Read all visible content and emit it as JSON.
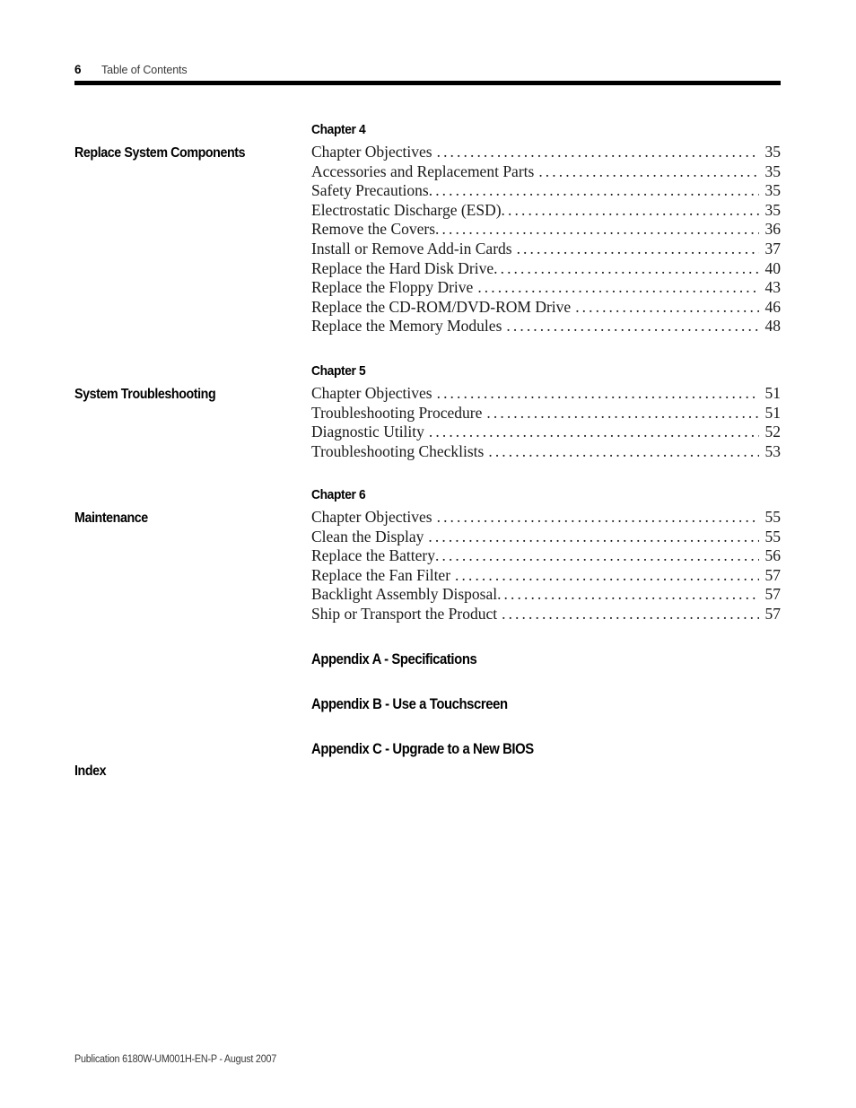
{
  "header": {
    "page_number": "6",
    "title": "Table of Contents"
  },
  "sections": [
    {
      "side_title": "Replace System Components",
      "chapter_label": "Chapter 4",
      "entries": [
        {
          "text": "Chapter Objectives",
          "page": "35",
          "space_before_leader": true
        },
        {
          "text": "Accessories and Replacement Parts",
          "page": "35",
          "space_before_leader": true
        },
        {
          "text": "Safety Precautions",
          "page": "35",
          "space_before_leader": false
        },
        {
          "text": "Electrostatic Discharge (ESD)",
          "page": "35",
          "space_before_leader": false
        },
        {
          "text": "Remove the Covers",
          "page": "36",
          "space_before_leader": false
        },
        {
          "text": "Install or Remove Add-in Cards",
          "page": "37",
          "space_before_leader": true
        },
        {
          "text": "Replace the Hard Disk Drive",
          "page": "40",
          "space_before_leader": false
        },
        {
          "text": "Replace the Floppy Drive",
          "page": "43",
          "space_before_leader": true
        },
        {
          "text": "Replace the CD-ROM/DVD-ROM Drive",
          "page": "46",
          "space_before_leader": true
        },
        {
          "text": "Replace the Memory Modules",
          "page": "48",
          "space_before_leader": true
        }
      ]
    },
    {
      "side_title": "System Troubleshooting",
      "chapter_label": "Chapter 5",
      "entries": [
        {
          "text": "Chapter Objectives",
          "page": "51",
          "space_before_leader": true
        },
        {
          "text": "Troubleshooting Procedure",
          "page": "51",
          "space_before_leader": true
        },
        {
          "text": "Diagnostic Utility",
          "page": "52",
          "space_before_leader": true
        },
        {
          "text": "Troubleshooting Checklists",
          "page": "53",
          "space_before_leader": true
        }
      ]
    },
    {
      "side_title": "Maintenance",
      "chapter_label": "Chapter 6",
      "entries": [
        {
          "text": "Chapter Objectives",
          "page": "55",
          "space_before_leader": true
        },
        {
          "text": "Clean the Display",
          "page": "55",
          "space_before_leader": true
        },
        {
          "text": "Replace the Battery",
          "page": "56",
          "space_before_leader": false
        },
        {
          "text": "Replace the Fan Filter",
          "page": "57",
          "space_before_leader": true
        },
        {
          "text": "Backlight Assembly Disposal",
          "page": "57",
          "space_before_leader": false
        },
        {
          "text": "Ship or Transport the Product",
          "page": "57",
          "space_before_leader": true
        }
      ]
    }
  ],
  "appendices": [
    {
      "label": "Appendix A - Specifications"
    },
    {
      "label": "Appendix B - Use a Touchscreen"
    },
    {
      "label": "Appendix C - Upgrade to a New BIOS"
    }
  ],
  "index": {
    "label": "Index"
  },
  "footer": {
    "text": "Publication 6180W-UM001H-EN-P - August 2007"
  },
  "leader_dots": "...................................................................................."
}
